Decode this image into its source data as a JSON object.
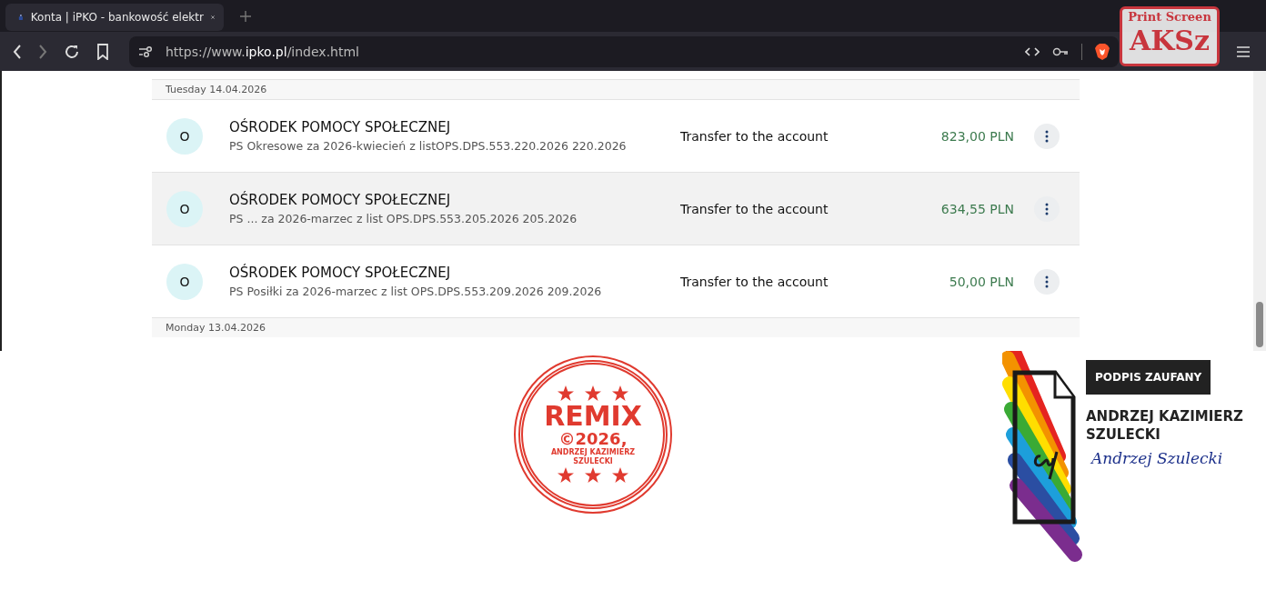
{
  "browser": {
    "tab_title": "Konta | iPKO - bankowość elektr",
    "url_prefix": "https://www.",
    "url_host": "ipko.pl",
    "url_path": "/index.html"
  },
  "overlay_stamp": {
    "line1": "Print Screen",
    "line2": "AKSz"
  },
  "rows": [
    {
      "kind": "date",
      "text": "Tuesday 14.04.2026"
    },
    {
      "kind": "transaction",
      "avatar": "O",
      "name": "OŚRODEK POMOCY SPOŁECZNEJ",
      "description": "PS Okresowe za 2026-kwiecień z listOPS.DPS.553.220.2026 220.2026",
      "type": "Transfer to the account",
      "amount": "823,00 PLN",
      "hovered": false
    },
    {
      "kind": "transaction",
      "avatar": "O",
      "name": "OŚRODEK POMOCY SPOŁECZNEJ",
      "description": "PS ... za 2026-marzec z list OPS.DPS.553.205.2026 205.2026",
      "type": "Transfer to the account",
      "amount": "634,55 PLN",
      "hovered": true
    },
    {
      "kind": "transaction",
      "avatar": "O",
      "name": "OŚRODEK POMOCY SPOŁECZNEJ",
      "description": "PS Posiłki za 2026-marzec z list OPS.DPS.553.209.2026 209.2026",
      "type": "Transfer to the account",
      "amount": "50,00 PLN",
      "hovered": false
    },
    {
      "kind": "date",
      "text": "Monday 13.04.2026"
    }
  ],
  "remix_stamp": {
    "title": "REMIX",
    "year": "©2026,",
    "author_line1": "ANDRZEJ KAZIMIERZ",
    "author_line2": "SZULECKI"
  },
  "signature_stamp": {
    "label": "PODPIS ZAUFANY",
    "name_line1": "ANDRZEJ KAZIMIERZ",
    "name_line2": "SZULECKI",
    "signature": "Andrzej Szulecki"
  }
}
